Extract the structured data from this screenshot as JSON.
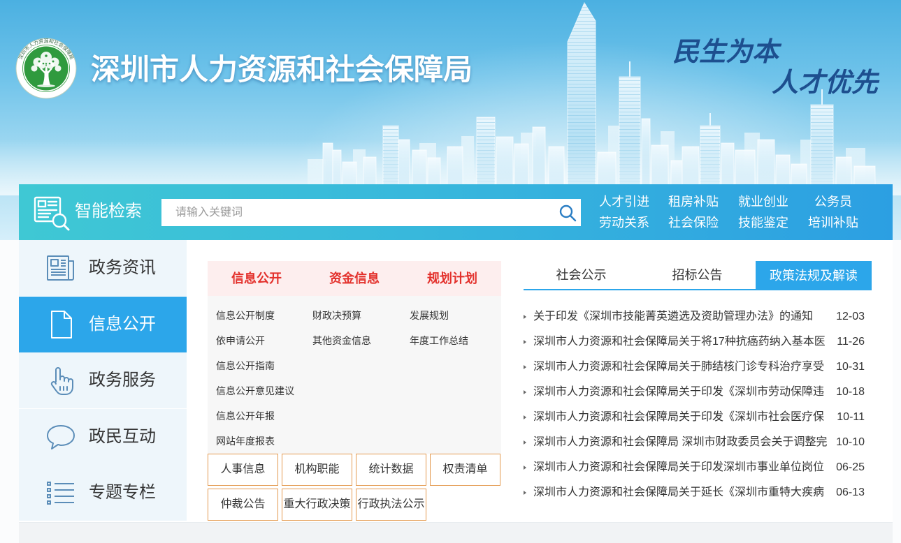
{
  "header": {
    "logo_ring_text": "深圳市人力资源和社会保障局",
    "title": "深圳市人力资源和社会保障局",
    "slogan_line1": "民生为本",
    "slogan_line2": "人才优先"
  },
  "search": {
    "icon": "document-search-icon",
    "label": "智能检索",
    "placeholder": "请输入关键词",
    "value": "",
    "button_icon": "search-icon"
  },
  "quick_links": [
    {
      "label": "人才引进"
    },
    {
      "label": "租房补贴"
    },
    {
      "label": "就业创业"
    },
    {
      "label": "公务员"
    },
    {
      "label": "劳动关系"
    },
    {
      "label": "社会保险"
    },
    {
      "label": "技能鉴定"
    },
    {
      "label": "培训补贴"
    }
  ],
  "sidebar": {
    "items": [
      {
        "label": "政务资讯",
        "icon": "newspaper-icon",
        "active": false
      },
      {
        "label": "信息公开",
        "icon": "document-icon",
        "active": true
      },
      {
        "label": "政务服务",
        "icon": "hand-pointer-icon",
        "active": false
      },
      {
        "label": "政民互动",
        "icon": "speech-bubble-icon",
        "active": false
      },
      {
        "label": "专题专栏",
        "icon": "list-icon",
        "active": false
      }
    ]
  },
  "info_panel": {
    "tabs": [
      {
        "label": "信息公开"
      },
      {
        "label": "资金信息"
      },
      {
        "label": "规划计划"
      }
    ],
    "columns": [
      [
        "信息公开制度",
        "依申请公开",
        "信息公开指南",
        "信息公开意见建议",
        "信息公开年报",
        "网站年度报表"
      ],
      [
        "财政决预算",
        "其他资金信息"
      ],
      [
        "发展规划",
        "年度工作总结"
      ]
    ],
    "buttons": [
      "人事信息",
      "机构职能",
      "统计数据",
      "权责清单",
      "仲裁公告",
      "重大行政决策",
      "行政执法公示"
    ]
  },
  "news_panel": {
    "tabs": [
      {
        "label": "社会公示",
        "active": false
      },
      {
        "label": "招标公告",
        "active": false
      },
      {
        "label": "政策法规及解读",
        "active": true
      }
    ],
    "items": [
      {
        "title": "关于印发《深圳市技能菁英遴选及资助管理办法》的通知",
        "date": "12-03"
      },
      {
        "title": "深圳市人力资源和社会保障局关于将17种抗癌药纳入基本医",
        "date": "11-26"
      },
      {
        "title": "深圳市人力资源和社会保障局关于肺结核门诊专科治疗享受",
        "date": "10-31"
      },
      {
        "title": "深圳市人力资源和社会保障局关于印发《深圳市劳动保障违",
        "date": "10-18"
      },
      {
        "title": "深圳市人力资源和社会保障局关于印发《深圳市社会医疗保",
        "date": "10-11"
      },
      {
        "title": "深圳市人力资源和社会保障局 深圳市财政委员会关于调整完",
        "date": "10-10"
      },
      {
        "title": "深圳市人力资源和社会保障局关于印发深圳市事业单位岗位",
        "date": "06-25"
      },
      {
        "title": "深圳市人力资源和社会保障局关于延长《深圳市重特大疾病",
        "date": "06-13"
      }
    ]
  },
  "colors": {
    "accent_blue": "#2ca6ea",
    "tab_red": "#e3302b",
    "tab_header_pink": "#fdeeee",
    "button_border_orange": "#e49a50",
    "sidebar_bg": "#eef6fb",
    "search_strip_start": "#3fc8d4",
    "search_strip_end": "#2c9fe2",
    "logo_green": "#2f9a3e",
    "slogan_blue": "#1d4f8f"
  }
}
